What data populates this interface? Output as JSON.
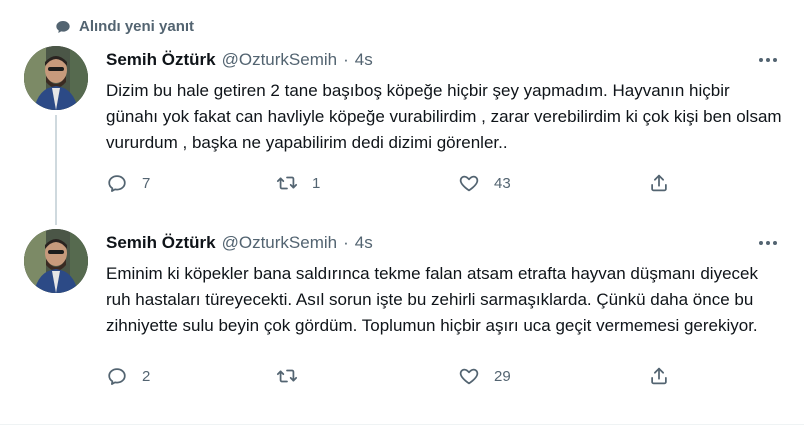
{
  "context": {
    "label": "Alındı yeni yanıt"
  },
  "tweets": [
    {
      "name": "Semih Öztürk",
      "handle": "@OzturkSemih",
      "separator": "·",
      "time": "4s",
      "text": "Dizim bu hale getiren 2 tane başıboş köpeğe hiçbir şey yapmadım. Hayvanın hiçbir günahı yok fakat can havliyle köpeğe vurabilirdim , zarar verebilirdim ki çok kişi ben olsam vururdum , başka ne yapabilirim dedi dizimi görenler..",
      "replies": "7",
      "retweets": "1",
      "likes": "43"
    },
    {
      "name": "Semih Öztürk",
      "handle": "@OzturkSemih",
      "separator": "·",
      "time": "4s",
      "text": "Eminim ki köpekler bana saldırınca tekme falan atsam etrafta hayvan düşmanı diyecek ruh hastaları türeyecekti. Asıl sorun işte bu zehirli sarmaşıklarda. Çünkü daha önce bu zihniyette sulu beyin çok gördüm. Toplumun hiçbir aşırı uca geçit vermemesi gerekiyor.",
      "replies": "2",
      "retweets": "",
      "likes": "29"
    }
  ],
  "icons": {
    "context": "speech-bubble-icon",
    "more": "more-options-icon",
    "reply": "reply-icon",
    "retweet": "retweet-icon",
    "like": "heart-icon",
    "share": "share-icon"
  },
  "colors": {
    "text": "#0f1419",
    "secondary": "#536471",
    "thread_line": "#cfd9de"
  }
}
